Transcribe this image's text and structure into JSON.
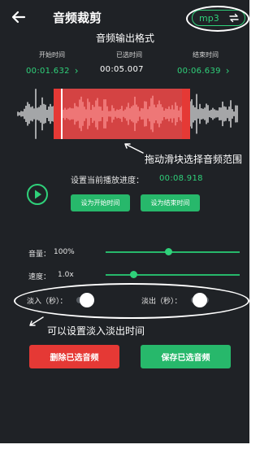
{
  "header": {
    "title": "音频裁剪",
    "format": "mp3"
  },
  "annotations": {
    "format_note": "音频输出格式",
    "drag_note": "拖动滑块选择音频范围",
    "fade_note": "可以设置淡入淡出时间"
  },
  "times": {
    "start_label": "开始时间",
    "selected_label": "已选时间",
    "end_label": "结束时间",
    "start_value": "00:01.632",
    "selected_value": "00:05.007",
    "end_value": "00:06.639"
  },
  "playback": {
    "progress_label": "设置当前播放进度：",
    "progress_value": "00:08.918",
    "set_start_label": "设为开始时间",
    "set_end_label": "设为结束时间"
  },
  "settings": {
    "volume_label": "音量：",
    "volume_value": "100%",
    "volume_fraction": 0.47,
    "speed_label": "速度：",
    "speed_value": "1.0x",
    "speed_fraction": 0.19,
    "fade_in_label": "淡入（秒）：",
    "fade_out_label": "淡出（秒）："
  },
  "actions": {
    "delete_label": "删除已选音频",
    "save_label": "保存已选音频"
  },
  "colors": {
    "accent": "#2fd17a",
    "danger": "#e53935",
    "background": "#1f2226"
  }
}
